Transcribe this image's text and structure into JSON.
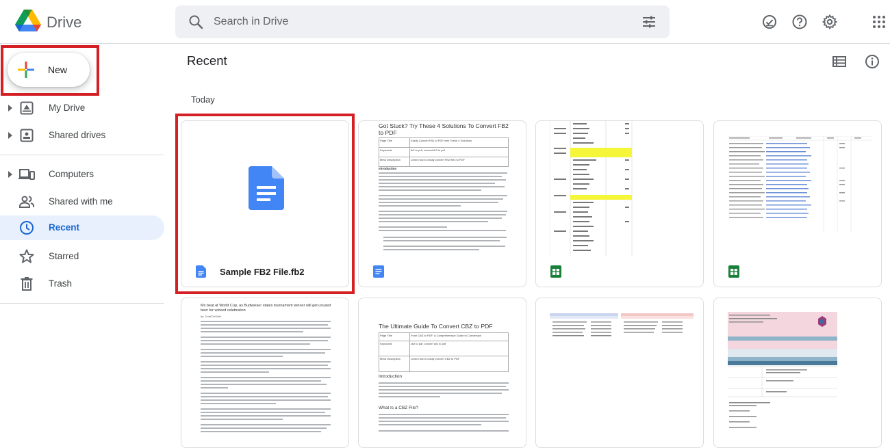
{
  "app": {
    "title": "Drive",
    "logo_icon": "google-drive-logo"
  },
  "search": {
    "placeholder": "Search in Drive",
    "icon": "search-icon",
    "filter_icon": "tune-icon"
  },
  "header_actions": [
    {
      "name": "ready-for-offline-icon"
    },
    {
      "name": "help-icon"
    },
    {
      "name": "settings-icon"
    },
    {
      "name": "apps-grid-icon"
    }
  ],
  "sidebar": {
    "new_label": "New",
    "items": [
      {
        "label": "My Drive",
        "icon": "my-drive-icon",
        "expandable": true
      },
      {
        "label": "Shared drives",
        "icon": "shared-drives-icon",
        "expandable": true
      },
      {
        "label": "Computers",
        "icon": "computers-icon",
        "expandable": true
      },
      {
        "label": "Shared with me",
        "icon": "shared-with-me-icon",
        "expandable": false
      },
      {
        "label": "Recent",
        "icon": "recent-icon",
        "expandable": false,
        "active": true
      },
      {
        "label": "Starred",
        "icon": "star-icon",
        "expandable": false
      },
      {
        "label": "Trash",
        "icon": "trash-icon",
        "expandable": false
      }
    ]
  },
  "main": {
    "title": "Recent",
    "section": "Today",
    "view_icon": "list-view-icon",
    "info_icon": "info-icon",
    "files": [
      {
        "name": "Sample FB2 File.fb2",
        "type": "docs",
        "selected": true
      },
      {
        "name": "",
        "type": "docs",
        "preview_title": "Got Stuck? Try These 4 Solutions To Convert FB2 to PDF",
        "preview_rows": [
          [
            "Page Title",
            "Easily Convert FB2 to PDF with These 4 Solutions"
          ],
          [
            "Keywords",
            "fb2 to pdf, convert fb2 to pdf"
          ],
          [
            "Meta Description",
            "Learn how to easily convert FB2 files to PDF"
          ]
        ],
        "preview_heading": "Introduction"
      },
      {
        "name": "",
        "type": "sheets"
      },
      {
        "name": "",
        "type": "sheets"
      },
      {
        "name": "",
        "type": "docs",
        "preview_title": "Ms beat at World Cup, as Budweiser states tournament winner will get unused beer for wicked celebration",
        "preview_byline": "by: Todd DeSolle"
      },
      {
        "name": "",
        "type": "docs",
        "preview_title": "The Ultimate Guide To Convert CBZ to PDF",
        "preview_rows": [
          [
            "Page Title",
            "From CBZ to PDF: A Comprehensive Guide to Conversion"
          ],
          [
            "Keywords",
            "cbz to pdf, convert cbz to pdf"
          ],
          [
            "Meta Description",
            "Learn how to easily convert CBZ to PDF"
          ]
        ],
        "preview_heading": "Introduction",
        "preview_heading2": "What Is a CBZ File?"
      },
      {
        "name": "",
        "type": "sheets"
      },
      {
        "name": "",
        "type": "sheets"
      }
    ]
  },
  "colors": {
    "accent": "#1967d2",
    "highlight_box": "#d41f25",
    "docs_blue": "#4285f4",
    "sheets_green": "#188038",
    "active_bg": "#e8f0fe"
  }
}
